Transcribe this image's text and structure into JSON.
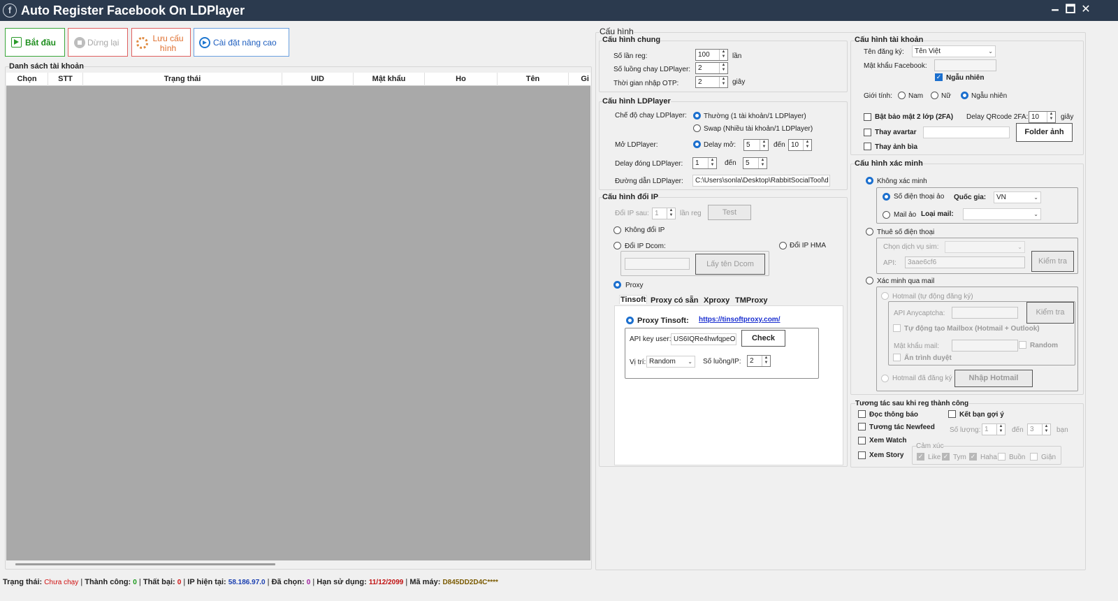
{
  "window": {
    "title": "Auto Register Facebook On LDPlayer",
    "logo": "f",
    "min": "🗕",
    "max": "🗖",
    "close": "✕"
  },
  "toolbar": {
    "start": "Bắt đầu",
    "stop": "Dừng lại",
    "save": "Lưu cấu hình",
    "advanced": "Cài đặt nâng cao"
  },
  "accounts": {
    "title": "Danh sách tài khoản",
    "columns": [
      "Chọn",
      "STT",
      "Trạng thái",
      "UID",
      "Mật khẩu",
      "Ho",
      "Tên",
      "Gi"
    ]
  },
  "config": {
    "title": "Cấu hình",
    "general": {
      "title": "Cấu hình chung",
      "reg_count_label": "Số lần reg:",
      "reg_count": "100",
      "reg_unit": "lần",
      "threads_label": "Số luồng chay LDPlayer:",
      "threads": "2",
      "otp_label": "Thời gian nhập OTP:",
      "otp": "2",
      "otp_unit": "giây"
    },
    "ld": {
      "title": "Cấu hình LDPlayer",
      "mode_label": "Chế độ chay LDPlayer:",
      "mode_normal": "Thường (1 tài khoản/1 LDPlayer)",
      "mode_swap": "Swap (Nhiều tài khoản/1 LDPlayer)",
      "open_label": "Mở LDPlayer:",
      "delay_open": "Delay mở:",
      "open_from": "5",
      "open_to_label": "đến",
      "open_to": "10",
      "close_label": "Delay đóng LDPlayer:",
      "close_from": "1",
      "close_to_label": "đến",
      "close_to": "5",
      "path_label": "Đường dẫn LDPlayer:",
      "path": "C:\\Users\\sonla\\Desktop\\RabbitSocialTool\\d"
    },
    "ip": {
      "title": "Cấu hình đổi IP",
      "change_after": "Đổi IP sau:",
      "change_after_val": "1",
      "reg_unit": "lần reg",
      "test": "Test",
      "no_change": "Không đổi IP",
      "dcom": "Đổi IP Dcom:",
      "hma": "Đổi IP HMA",
      "get_dcom": "Lấy tên Dcom",
      "proxy": "Proxy",
      "tabs": [
        "Tinsoft",
        "Proxy có sẵn",
        "Xproxy",
        "TMProxy"
      ],
      "tinsoft_label": "Proxy Tinsoft:",
      "tinsoft_link": "https://tinsoftproxy.com/",
      "api_label": "API key user:",
      "api_value": "US6IQRe4hwfqpeO",
      "check": "Check",
      "location_label": "Vị trí:",
      "location": "Random",
      "per_ip_label": "Số luồng/IP:",
      "per_ip": "2"
    },
    "account": {
      "title": "Cấu hình tài khoản",
      "name_label": "Tên đăng ký:",
      "name": "Tên Việt",
      "password_label": "Mật khẩu Facebook:",
      "random_label": "Ngẫu nhiên",
      "gender_label": "Giới tính:",
      "male": "Nam",
      "female": "Nữ",
      "gender_random": "Ngẫu nhiên",
      "twofa": "Bật bảo mật 2 lớp (2FA)",
      "qr_delay_label": "Delay QRcode 2FA:",
      "qr_delay": "10",
      "qr_unit": "giây",
      "avatar": "Thay avartar",
      "folder": "Folder ảnh",
      "cover": "Thay ảnh bìa"
    },
    "verify": {
      "title": "Cấu hình xác minh",
      "none": "Không xác minh",
      "phone_virtual": "Số điện thoại ảo",
      "country_label": "Quốc gia:",
      "country": "VN",
      "mail_virtual": "Mail ảo",
      "mail_type_label": "Loại mail:",
      "rent_phone": "Thuê số điện thoại",
      "sim_label": "Chọn dịch vụ sim:",
      "api_label": "API:",
      "api_value": "3aae6cf6",
      "check": "Kiểm tra",
      "via_mail": "Xác minh qua mail",
      "hotmail_auto": "Hotmail (tự động đăng ký)",
      "anycaptcha_label": "API Anycaptcha:",
      "check2": "Kiểm tra",
      "auto_mailbox": "Tự động tạo Mailbox (Hotmail + Outlook)",
      "mail_password_label": "Mật khẩu mail:",
      "random": "Random",
      "hide_browser": "Ẩn trình duyệt",
      "hotmail_registered": "Hotmail đã đăng ký",
      "import_hotmail": "Nhập Hotmail"
    },
    "interact": {
      "title": "Tương tác sau khi reg thành công",
      "read_notif": "Đọc thông báo",
      "add_friends": "Kết bạn gợi ý",
      "newsfeed": "Tương tác Newfeed",
      "qty_label": "Số lượng:",
      "qty_from": "1",
      "qty_to_label": "đến",
      "qty_to": "3",
      "qty_unit": "bạn",
      "watch": "Xem Watch",
      "story": "Xem Story",
      "emotion_title": "Cảm xúc",
      "like": "Like",
      "love": "Tym",
      "haha": "Haha",
      "sad": "Buồn",
      "angry": "Giận"
    }
  },
  "status": {
    "state_label": "Trạng thái:",
    "state": "Chưa chạy",
    "success_label": "Thành công:",
    "success": "0",
    "fail_label": "Thất bại:",
    "fail": "0",
    "ip_label": "IP hiện tại:",
    "ip": "58.186.97.0",
    "selected_label": "Đã chọn:",
    "selected": "0",
    "expiry_label": "Hạn sử dụng:",
    "expiry": "11/12/2099",
    "machine_label": "Mã máy:",
    "machine": "D845DD2D4C****",
    "colors": {
      "state": "#d01010",
      "success": "#1a9a1a",
      "fail": "#d01010",
      "ip": "#1a3fb0",
      "selected": "#a020a0",
      "expiry": "#c01010",
      "machine": "#7a5a00"
    }
  }
}
